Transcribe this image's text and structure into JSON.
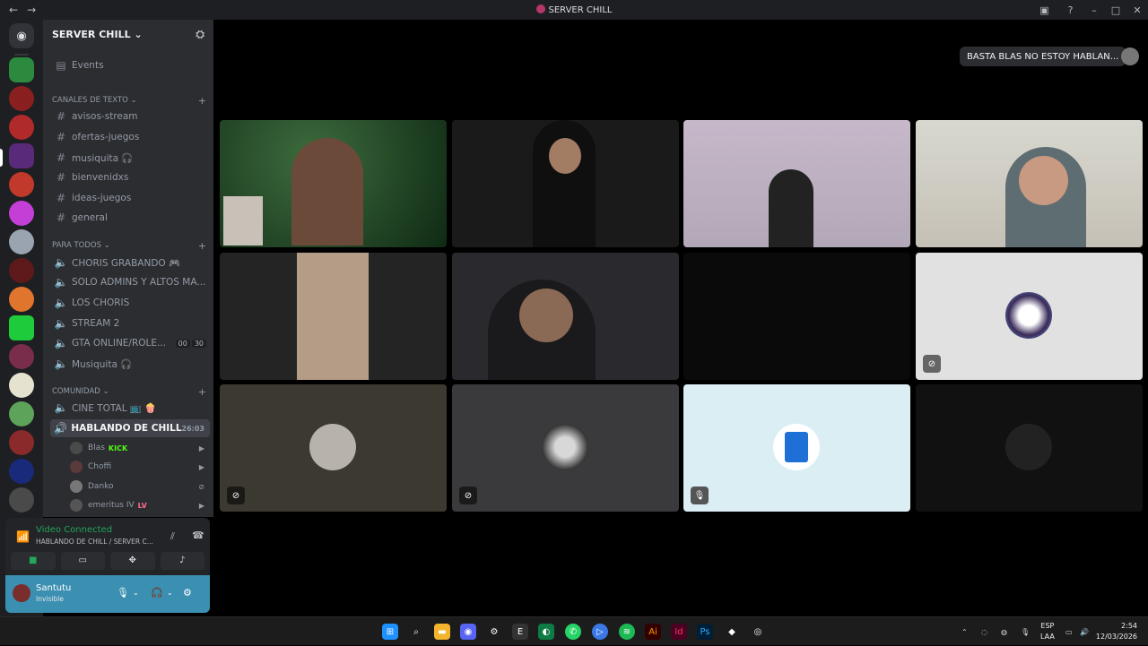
{
  "window": {
    "title": "SERVER CHILL"
  },
  "server": {
    "name": "SERVER CHILL"
  },
  "sidebar": {
    "events_label": "Events",
    "categories": [
      {
        "label": "Canales de texto"
      },
      {
        "label": "PARA TODOS"
      },
      {
        "label": "COMUNIDAD"
      }
    ],
    "text_channels": [
      "avisos-stream",
      "ofertas-juegos",
      "musiquita 🎧",
      "bienvenidxs",
      "ideas-juegos",
      "general"
    ],
    "voice_channels_todos": [
      "CHORIS GRABANDO 🎮",
      "SOLO ADMINS Y ALTOS MA...",
      "LOS CHORIS",
      "STREAM 2",
      "GTA ONLINE/ROLE...",
      "Musiquita 🎧"
    ],
    "gta_counts": [
      "00",
      "30"
    ],
    "voice_channels_comunidad": [
      "CINE TOTAL 📺 🍿",
      "HABLANDO DE CHILL"
    ],
    "active_timer": "26:03",
    "voice_users": [
      {
        "name": "Blas",
        "tag": "KICK"
      },
      {
        "name": "Choffi",
        "tag": ""
      },
      {
        "name": "Danko",
        "tag": ""
      },
      {
        "name": "emeritus IV",
        "tag": "LV"
      }
    ]
  },
  "voice_panel": {
    "status": "Video Connected",
    "channel": "HABLANDO DE CHILL / SERVER C..."
  },
  "user": {
    "name": "Santutu",
    "status": "Invisible"
  },
  "stage": {
    "activity_text": "BASTA BLAS NO ESTOY HABLAN..."
  },
  "taskbar": {
    "lang_top": "ESP",
    "lang_bottom": "LAA",
    "time": "2:54",
    "date": "12/03/2026"
  },
  "colors": {
    "accent_green": "#23a55a",
    "userbar": "#3b8fb0",
    "sidebar": "#2b2d31",
    "guilds": "#1e1f22"
  }
}
